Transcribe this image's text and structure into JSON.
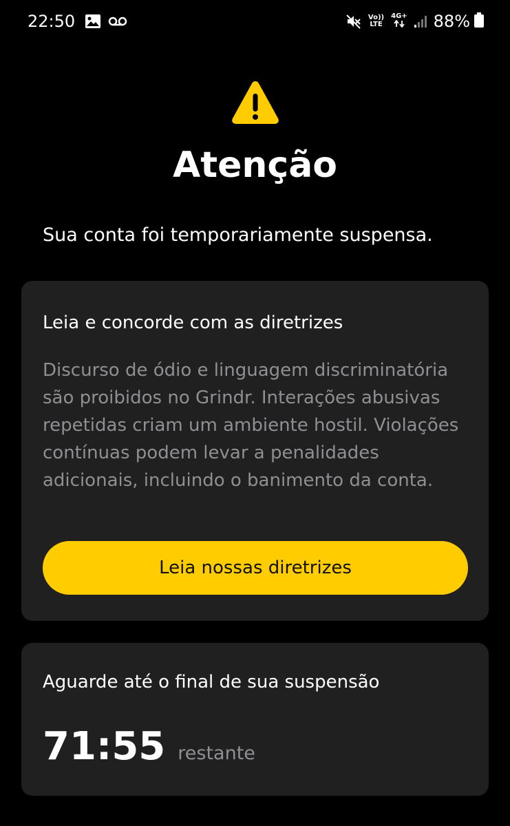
{
  "status_bar": {
    "time": "22:50",
    "left_icons": [
      "image-icon",
      "voicemail-icon"
    ],
    "right_icons": [
      "mute-icon",
      "volte-icon",
      "network-4g-icon",
      "signal-icon",
      "battery-icon"
    ],
    "volte_top": "Vo))",
    "volte_bottom": "LTE",
    "network_label": "4G+",
    "battery_percent": "88%"
  },
  "header": {
    "icon": "warning-icon",
    "title": "Atenção",
    "subtitle": "Sua conta foi temporariamente suspensa."
  },
  "guidelines_card": {
    "heading": "Leia e concorde com as diretrizes",
    "body": "Discurso de ódio e linguagem discriminatória são proibidos no Grindr. Interações abusivas repetidas criam um ambiente hostil. Violações contínuas podem levar a penalidades adicionais, incluindo o banimento da conta.",
    "button_label": "Leia nossas diretrizes"
  },
  "wait_card": {
    "heading": "Aguarde até o final de sua suspensão",
    "timer": "71:55",
    "timer_suffix": "restante"
  },
  "colors": {
    "background": "#000000",
    "card": "#202020",
    "accent": "#ffcc00",
    "muted_text": "#8f8f94"
  }
}
